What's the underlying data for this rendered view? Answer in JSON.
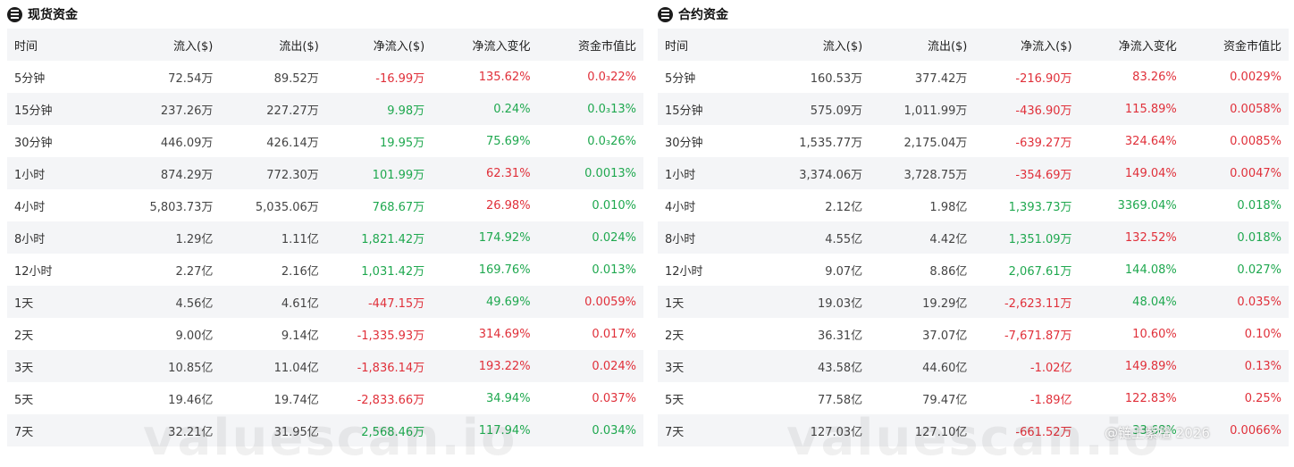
{
  "spot": {
    "title": "现货资金",
    "columns": [
      "时间",
      "流入($)",
      "流出($)",
      "净流入($)",
      "净流入变化",
      "资金市值比"
    ],
    "rows": [
      {
        "time": "5分钟",
        "inflow": "72.54万",
        "outflow": "89.52万",
        "net": "-16.99万",
        "change": "135.62%",
        "ratio": "0.0₃22%",
        "net_sign": "neg",
        "change_sign": "neg",
        "ratio_sign": "neg"
      },
      {
        "time": "15分钟",
        "inflow": "237.26万",
        "outflow": "227.27万",
        "net": "9.98万",
        "change": "0.24%",
        "ratio": "0.0₃13%",
        "net_sign": "pos",
        "change_sign": "pos",
        "ratio_sign": "pos"
      },
      {
        "time": "30分钟",
        "inflow": "446.09万",
        "outflow": "426.14万",
        "net": "19.95万",
        "change": "75.69%",
        "ratio": "0.0₃26%",
        "net_sign": "pos",
        "change_sign": "pos",
        "ratio_sign": "pos"
      },
      {
        "time": "1小时",
        "inflow": "874.29万",
        "outflow": "772.30万",
        "net": "101.99万",
        "change": "62.31%",
        "ratio": "0.0013%",
        "net_sign": "pos",
        "change_sign": "neg",
        "ratio_sign": "pos"
      },
      {
        "time": "4小时",
        "inflow": "5,803.73万",
        "outflow": "5,035.06万",
        "net": "768.67万",
        "change": "26.98%",
        "ratio": "0.010%",
        "net_sign": "pos",
        "change_sign": "neg",
        "ratio_sign": "pos"
      },
      {
        "time": "8小时",
        "inflow": "1.29亿",
        "outflow": "1.11亿",
        "net": "1,821.42万",
        "change": "174.92%",
        "ratio": "0.024%",
        "net_sign": "pos",
        "change_sign": "pos",
        "ratio_sign": "pos"
      },
      {
        "time": "12小时",
        "inflow": "2.27亿",
        "outflow": "2.16亿",
        "net": "1,031.42万",
        "change": "169.76%",
        "ratio": "0.013%",
        "net_sign": "pos",
        "change_sign": "pos",
        "ratio_sign": "pos"
      },
      {
        "time": "1天",
        "inflow": "4.56亿",
        "outflow": "4.61亿",
        "net": "-447.15万",
        "change": "49.69%",
        "ratio": "0.0059%",
        "net_sign": "neg",
        "change_sign": "pos",
        "ratio_sign": "neg"
      },
      {
        "time": "2天",
        "inflow": "9.00亿",
        "outflow": "9.14亿",
        "net": "-1,335.93万",
        "change": "314.69%",
        "ratio": "0.017%",
        "net_sign": "neg",
        "change_sign": "neg",
        "ratio_sign": "neg"
      },
      {
        "time": "3天",
        "inflow": "10.85亿",
        "outflow": "11.04亿",
        "net": "-1,836.14万",
        "change": "193.22%",
        "ratio": "0.024%",
        "net_sign": "neg",
        "change_sign": "neg",
        "ratio_sign": "neg"
      },
      {
        "time": "5天",
        "inflow": "19.46亿",
        "outflow": "19.74亿",
        "net": "-2,833.66万",
        "change": "34.94%",
        "ratio": "0.037%",
        "net_sign": "neg",
        "change_sign": "pos",
        "ratio_sign": "neg"
      },
      {
        "time": "7天",
        "inflow": "32.21亿",
        "outflow": "31.95亿",
        "net": "2,568.46万",
        "change": "117.94%",
        "ratio": "0.034%",
        "net_sign": "pos",
        "change_sign": "pos",
        "ratio_sign": "pos"
      }
    ]
  },
  "contract": {
    "title": "合约资金",
    "columns": [
      "时间",
      "流入($)",
      "流出($)",
      "净流入($)",
      "净流入变化",
      "资金市值比"
    ],
    "rows": [
      {
        "time": "5分钟",
        "inflow": "160.53万",
        "outflow": "377.42万",
        "net": "-216.90万",
        "change": "83.26%",
        "ratio": "0.0029%",
        "net_sign": "neg",
        "change_sign": "neg",
        "ratio_sign": "neg"
      },
      {
        "time": "15分钟",
        "inflow": "575.09万",
        "outflow": "1,011.99万",
        "net": "-436.90万",
        "change": "115.89%",
        "ratio": "0.0058%",
        "net_sign": "neg",
        "change_sign": "neg",
        "ratio_sign": "neg"
      },
      {
        "time": "30分钟",
        "inflow": "1,535.77万",
        "outflow": "2,175.04万",
        "net": "-639.27万",
        "change": "324.64%",
        "ratio": "0.0085%",
        "net_sign": "neg",
        "change_sign": "neg",
        "ratio_sign": "neg"
      },
      {
        "time": "1小时",
        "inflow": "3,374.06万",
        "outflow": "3,728.75万",
        "net": "-354.69万",
        "change": "149.04%",
        "ratio": "0.0047%",
        "net_sign": "neg",
        "change_sign": "neg",
        "ratio_sign": "neg"
      },
      {
        "time": "4小时",
        "inflow": "2.12亿",
        "outflow": "1.98亿",
        "net": "1,393.73万",
        "change": "3369.04%",
        "ratio": "0.018%",
        "net_sign": "pos",
        "change_sign": "pos",
        "ratio_sign": "pos"
      },
      {
        "time": "8小时",
        "inflow": "4.55亿",
        "outflow": "4.42亿",
        "net": "1,351.09万",
        "change": "132.52%",
        "ratio": "0.018%",
        "net_sign": "pos",
        "change_sign": "neg",
        "ratio_sign": "pos"
      },
      {
        "time": "12小时",
        "inflow": "9.07亿",
        "outflow": "8.86亿",
        "net": "2,067.61万",
        "change": "144.08%",
        "ratio": "0.027%",
        "net_sign": "pos",
        "change_sign": "pos",
        "ratio_sign": "pos"
      },
      {
        "time": "1天",
        "inflow": "19.03亿",
        "outflow": "19.29亿",
        "net": "-2,623.11万",
        "change": "48.04%",
        "ratio": "0.035%",
        "net_sign": "neg",
        "change_sign": "pos",
        "ratio_sign": "neg"
      },
      {
        "time": "2天",
        "inflow": "36.31亿",
        "outflow": "37.07亿",
        "net": "-7,671.87万",
        "change": "10.60%",
        "ratio": "0.10%",
        "net_sign": "neg",
        "change_sign": "neg",
        "ratio_sign": "neg"
      },
      {
        "time": "3天",
        "inflow": "43.58亿",
        "outflow": "44.60亿",
        "net": "-1.02亿",
        "change": "149.89%",
        "ratio": "0.13%",
        "net_sign": "neg",
        "change_sign": "neg",
        "ratio_sign": "neg"
      },
      {
        "time": "5天",
        "inflow": "77.58亿",
        "outflow": "79.47亿",
        "net": "-1.89亿",
        "change": "122.83%",
        "ratio": "0.25%",
        "net_sign": "neg",
        "change_sign": "neg",
        "ratio_sign": "neg"
      },
      {
        "time": "7天",
        "inflow": "127.03亿",
        "outflow": "127.10亿",
        "net": "-661.52万",
        "change": "33.68%",
        "ratio": "0.0066%",
        "net_sign": "neg",
        "change_sign": "pos",
        "ratio_sign": "neg"
      }
    ]
  },
  "watermark": "valuescan.io",
  "credit": "@链上紫檀 2026",
  "colors": {
    "negative": "#e0303a",
    "positive": "#1fa84f",
    "stripe": "#f4f5f7",
    "header_bg": "#f4f5f7"
  },
  "icons": {
    "panel_logo": "layers-logo-icon"
  }
}
